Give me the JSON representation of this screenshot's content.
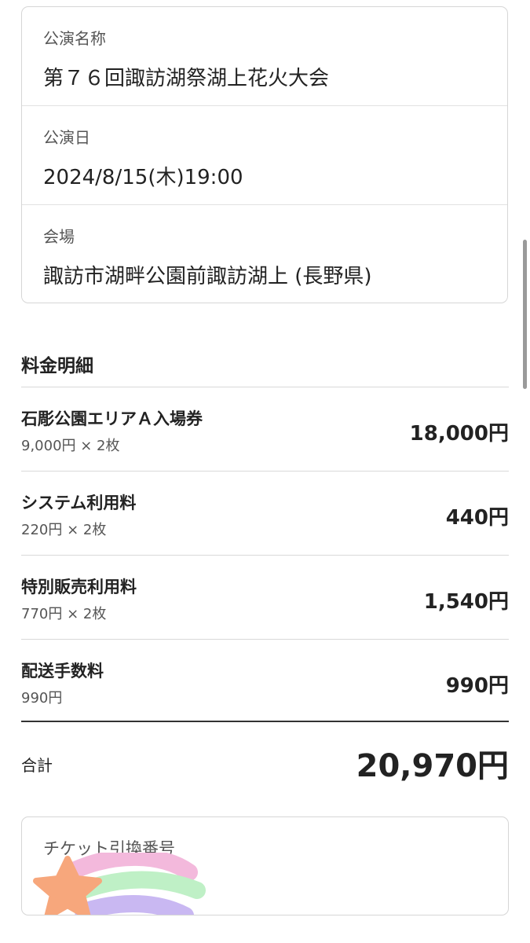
{
  "event_info": {
    "rows": [
      {
        "label": "公演名称",
        "value": "第７６回諏訪湖祭湖上花火大会"
      },
      {
        "label": "公演日",
        "value": "2024/8/15(木)19:00"
      },
      {
        "label": "会場",
        "value": "諏訪市湖畔公園前諏訪湖上 (長野県)"
      }
    ]
  },
  "fees": {
    "title": "料金明細",
    "items": [
      {
        "name": "石彫公園エリアＡ入場券",
        "detail": "9,000円 × 2枚",
        "amount": "18,000円"
      },
      {
        "name": "システム利用料",
        "detail": "220円 × 2枚",
        "amount": "440円"
      },
      {
        "name": "特別販売利用料",
        "detail": "770円 × 2枚",
        "amount": "1,540円"
      },
      {
        "name": "配送手数料",
        "detail": "990円",
        "amount": "990円"
      }
    ],
    "total_label": "合計",
    "total_amount": "20,970円"
  },
  "ticket": {
    "label": "チケット引換番号",
    "sticker": "shooting-star-sticker"
  },
  "colors": {
    "star": "#f7a77c",
    "pink": "#f3b9dc",
    "green": "#bff0c6",
    "purple": "#c9b8f2"
  }
}
